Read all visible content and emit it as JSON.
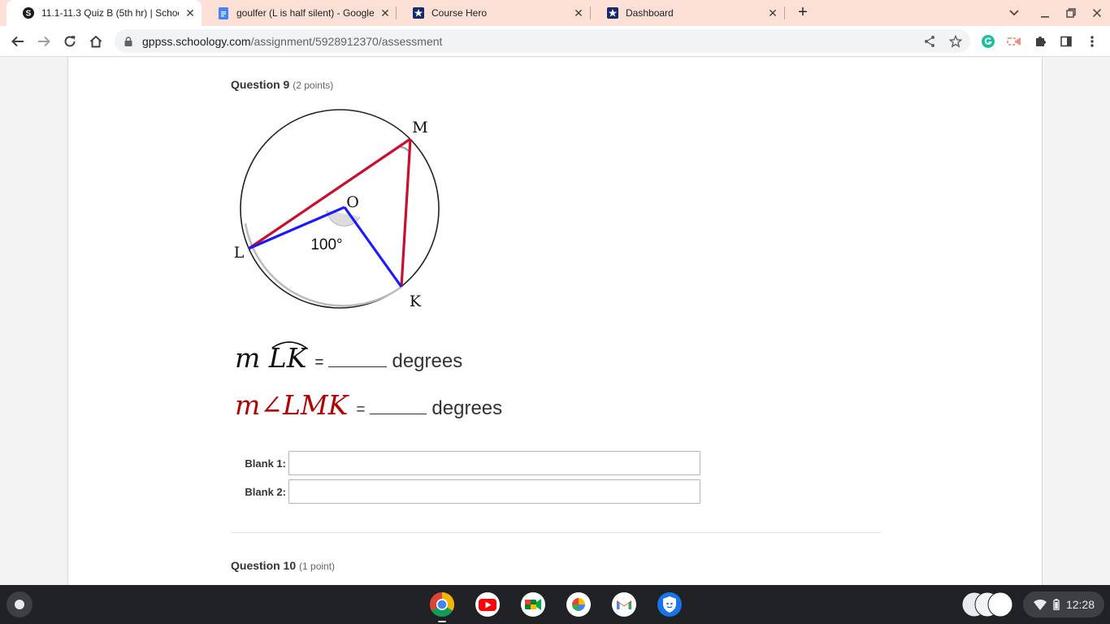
{
  "browser": {
    "tabs": [
      {
        "title": "11.1-11.3 Quiz B (5th hr) | Schoology",
        "icon": "schoology-icon",
        "active": true
      },
      {
        "title": "goulfer (L is half silent) - Google Docs",
        "icon": "google-docs-icon",
        "active": false
      },
      {
        "title": "Course Hero",
        "icon": "course-hero-icon",
        "active": false
      },
      {
        "title": "Dashboard",
        "icon": "course-hero-icon",
        "active": false
      }
    ],
    "url_host": "gppss.schoology.com",
    "url_path": "/assignment/5928912370/assessment"
  },
  "question9": {
    "label": "Question 9",
    "points": "(2 points)",
    "figure_labels": {
      "m": "M",
      "o": "O",
      "l": "L",
      "k": "K",
      "angle": "100°"
    },
    "eq1_math": "m LK",
    "eq1_m": "m",
    "eq1_arc": "LK",
    "eq2_math": "m∠LMK",
    "equals": "=",
    "unit": "degrees",
    "blanks": [
      {
        "label": "Blank 1:",
        "value": ""
      },
      {
        "label": "Blank 2:",
        "value": ""
      }
    ]
  },
  "question10": {
    "label": "Question 10",
    "points": "(1 point)"
  },
  "shelf": {
    "time": "12:28"
  },
  "colors": {
    "chord_red": "#c8102e",
    "radius_blue": "#1a1aff",
    "tab_strip": "#fde0d5",
    "eq2_red": "#b00000"
  }
}
